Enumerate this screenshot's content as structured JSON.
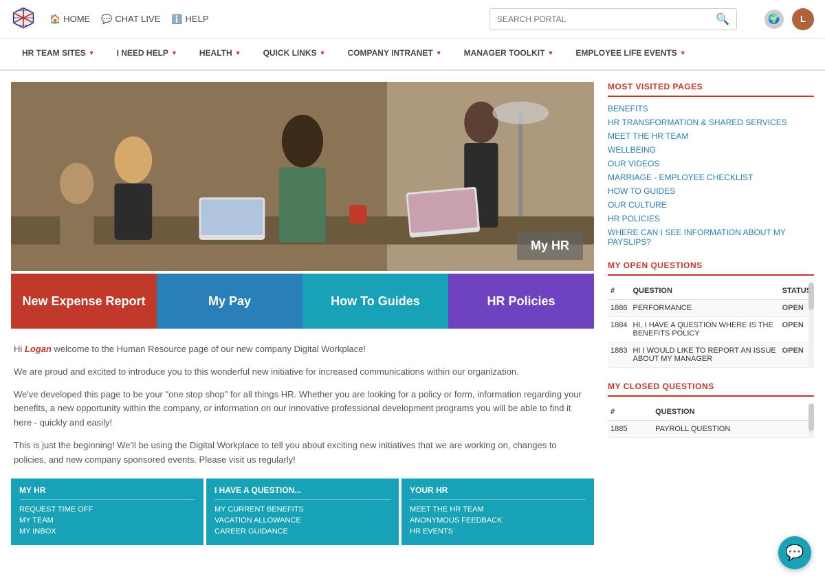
{
  "topbar": {
    "home_label": "HOME",
    "chat_label": "CHAT LIVE",
    "help_label": "HELP",
    "search_placeholder": "SEARCH PORTAL",
    "user_initials": "L"
  },
  "navbar": {
    "items": [
      {
        "label": "HR TEAM SITES"
      },
      {
        "label": "I NEED HELP"
      },
      {
        "label": "HEALTH"
      },
      {
        "label": "QUICK LINKS"
      },
      {
        "label": "COMPANY INTRANET"
      },
      {
        "label": "MANAGER TOOLKIT"
      },
      {
        "label": "EMPLOYEE LIFE EVENTS"
      }
    ]
  },
  "hero": {
    "overlay_text": "My HR"
  },
  "quick_tiles": [
    {
      "label": "New Expense Report",
      "color": "tile-red"
    },
    {
      "label": "My Pay",
      "color": "tile-blue"
    },
    {
      "label": "How To Guides",
      "color": "tile-teal"
    },
    {
      "label": "HR Policies",
      "color": "tile-purple"
    }
  ],
  "welcome": {
    "greeting_start": "Hi ",
    "name": "Logan",
    "greeting_end": " welcome to the Human Resource page of our new company Digital Workplace!",
    "paragraph1": "We are proud and excited to introduce you to this wonderful new initiative for increased communications within our organization.",
    "paragraph2": "We've developed this page to be your \"one stop shop\" for all things HR. Whether you are looking for a policy or form, information regarding your benefits, a new opportunity within the company, or information on our innovative professional development programs you will be able to find it here - quickly and easily!",
    "paragraph3": "This is just the beginning! We'll be using the Digital Workplace to tell you about exciting new initiatives that we are working on, changes to policies, and new company sponsored events. Please visit us regularly!"
  },
  "bottom_tiles": [
    {
      "header": "MY HR",
      "links": [
        "REQUEST TIME OFF",
        "MY TEAM",
        "MY INBOX"
      ]
    },
    {
      "header": "I HAVE A QUESTION...",
      "links": [
        "MY CURRENT BENEFITS",
        "VACATION ALLOWANCE",
        "CAREER GUIDANCE"
      ]
    },
    {
      "header": "YOUR HR",
      "links": [
        "MEET THE HR TEAM",
        "ANONYMOUS FEEDBACK",
        "HR EVENTS"
      ]
    }
  ],
  "sidebar": {
    "most_visited_title": "MOST VISITED PAGES",
    "most_visited_links": [
      "BENEFITS",
      "HR TRANSFORMATION & SHARED SERVICES",
      "MEET THE HR TEAM",
      "WELLBEING",
      "OUR VIDEOS",
      "MARRIAGE - EMPLOYEE CHECKLIST",
      "HOW TO GUIDES",
      "OUR CULTURE",
      "HR POLICIES",
      "WHERE CAN I SEE INFORMATION ABOUT MY PAYSLIPS?"
    ],
    "open_questions_title": "MY OPEN QUESTIONS",
    "open_questions_columns": {
      "num": "#",
      "question": "QUESTION",
      "status": "STATUS"
    },
    "open_questions": [
      {
        "num": "1886",
        "question": "PERFORMANCE",
        "status": "OPEN"
      },
      {
        "num": "1884",
        "question": "HI, I HAVE A QUESTION WHERE IS THE BENEFITS POLICY",
        "status": "OPEN"
      },
      {
        "num": "1883",
        "question": "HI I WOULD LIKE TO REPORT AN ISSUE ABOUT MY MANAGER",
        "status": "OPEN"
      }
    ],
    "closed_questions_title": "MY CLOSED QUESTIONS",
    "closed_questions_columns": {
      "num": "#",
      "question": "QUESTION"
    },
    "closed_questions": [
      {
        "num": "1885",
        "question": "PAYROLL QUESTION"
      }
    ]
  }
}
